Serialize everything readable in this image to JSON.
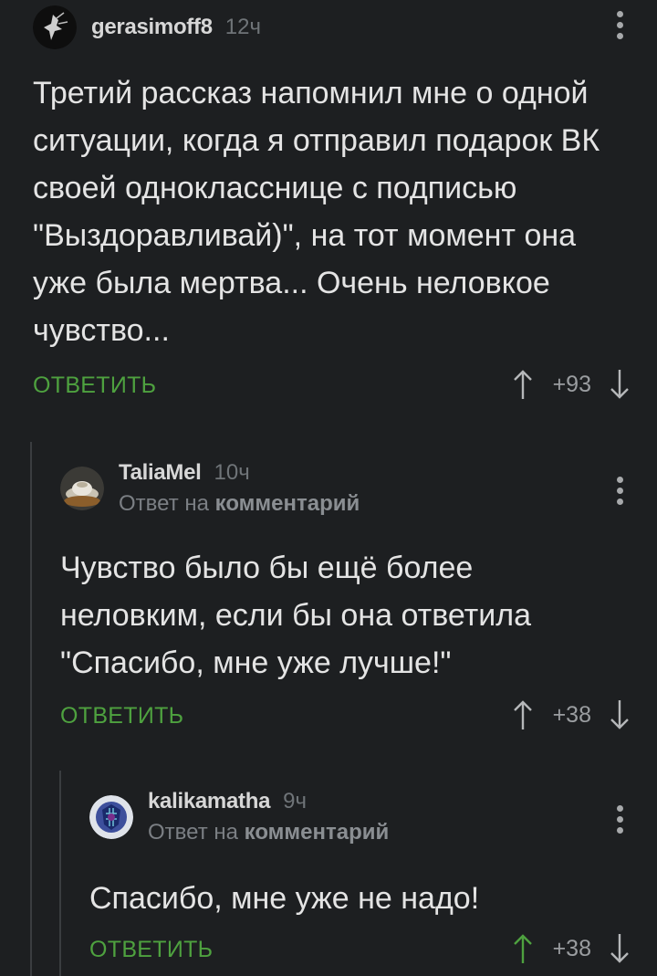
{
  "comments": [
    {
      "author": "gerasimoff8",
      "time": "12ч",
      "text": "Третий рассказ напомнил мне о одной ситуации, когда я отправил подарок ВК своей однокласснице с подписью \"Выздоравливай)\", на тот момент она уже была мертва... Очень неловкое чувство...",
      "reply_label": "ОТВЕТИТЬ",
      "rating": "+93"
    },
    {
      "author": "TaliaMel",
      "time": "10ч",
      "reply_to_prefix": "Ответ на",
      "reply_to_link": "комментарий",
      "text": "Чувство было бы ещё более неловким, если бы она ответила \"Спасибо, мне уже лучше!\"",
      "reply_label": "ОТВЕТИТЬ",
      "rating": "+38"
    },
    {
      "author": "kalikamatha",
      "time": "9ч",
      "reply_to_prefix": "Ответ на",
      "reply_to_link": "комментарий",
      "text": "Спасибо, мне уже не надо!",
      "reply_label": "ОТВЕТИТЬ",
      "rating": "+38",
      "upvoted": true
    }
  ],
  "colors": {
    "background": "#1d1f21",
    "accent_green": "#4ea13f",
    "text": "#e4e4e4",
    "muted": "#7b7f84"
  }
}
